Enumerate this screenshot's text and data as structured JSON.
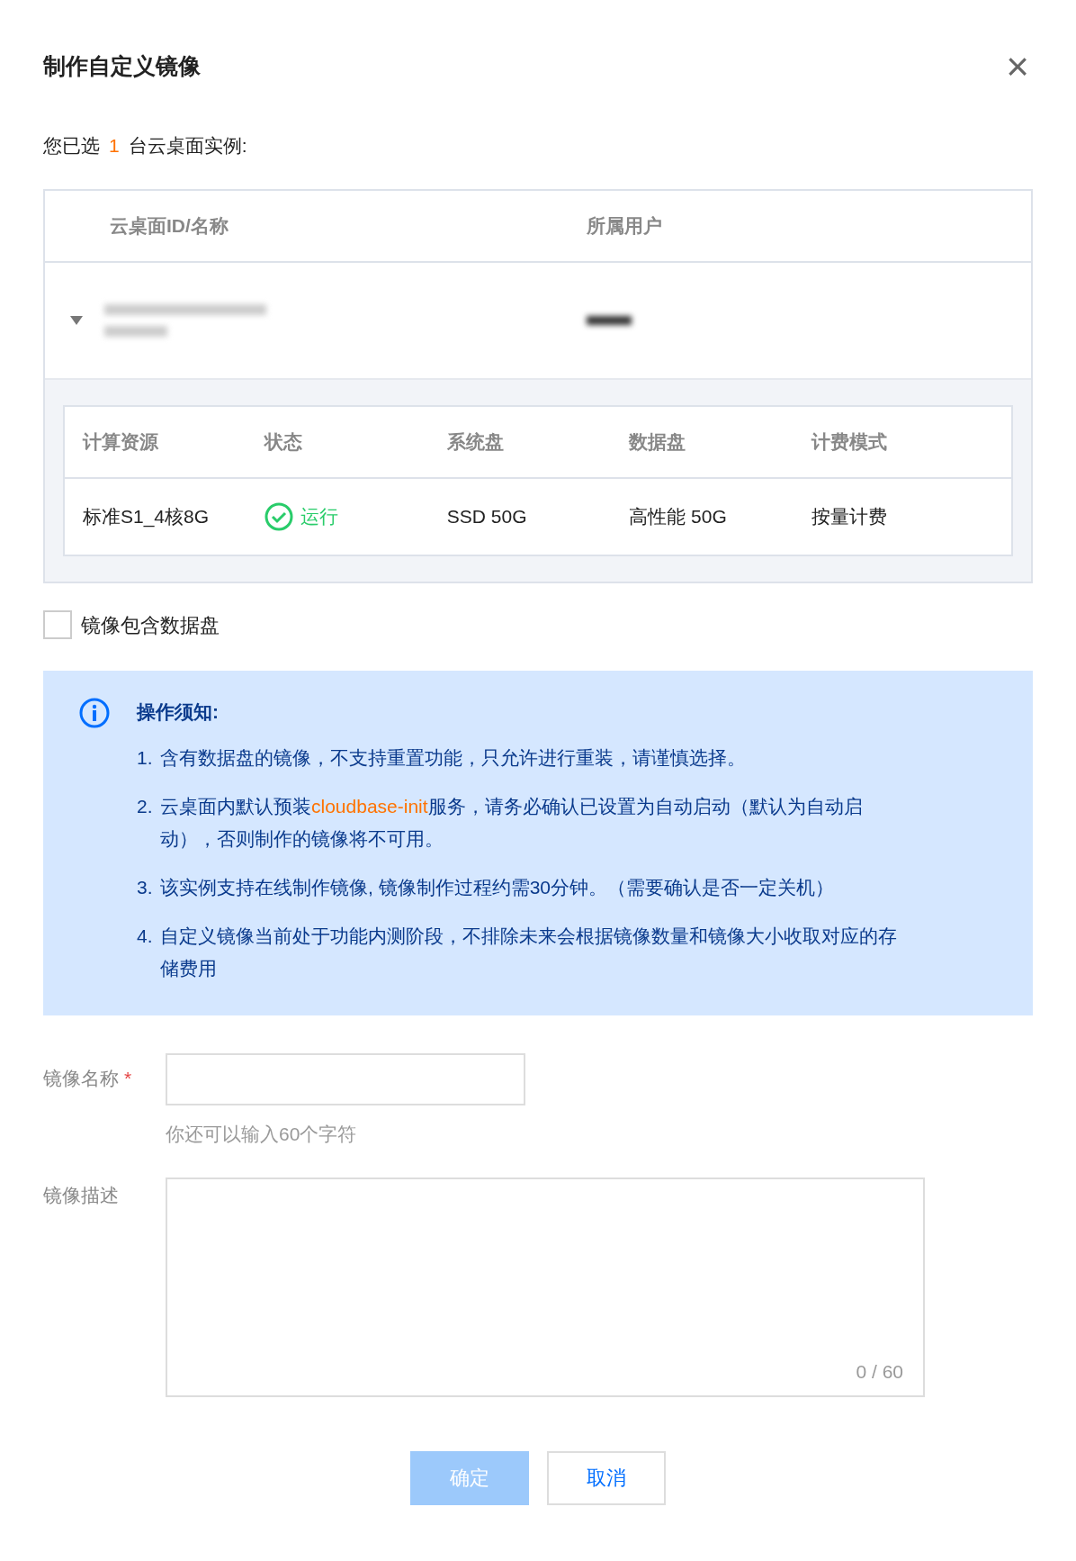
{
  "dialog": {
    "title": "制作自定义镜像",
    "close": "×"
  },
  "selection": {
    "prefix": "您已选",
    "count": "1",
    "suffix": "台云桌面实例:"
  },
  "instances_table": {
    "columns": [
      "云桌面ID/名称",
      "所属用户"
    ],
    "rows": [
      {
        "expanded": true,
        "details": {
          "columns": [
            "计算资源",
            "状态",
            "系统盘",
            "数据盘",
            "计费模式"
          ],
          "row": {
            "compute": "标准S1_4核8G",
            "status": {
              "text": "运行",
              "kind": "running"
            },
            "system_disk": "SSD 50G",
            "data_disk": "高性能 50G",
            "billing": "按量计费"
          }
        }
      }
    ]
  },
  "include_data_disk": {
    "label": "镜像包含数据盘",
    "checked": false
  },
  "notice": {
    "title": "操作须知:",
    "items": [
      {
        "number": "1.",
        "text": "含有数据盘的镜像，不支持重置功能，只允许进行重装，请谨慎选择。"
      },
      {
        "number": "2.",
        "text": "云桌面内默认预装",
        "link": "cloudbase-init",
        "after": "服务，请务必确认已设置为自动启动（默认为自动启动），否则制作的镜像将不可用。"
      },
      {
        "number": "3.",
        "text": "该实例支持在线制作镜像, 镜像制作过程约需30分钟。（需要确认是否一定关机）"
      },
      {
        "number": "4.",
        "text": "自定义镜像当前处于功能内测阶段，不排除未来会根据镜像数量和镜像大小收取对应的存储费用"
      }
    ]
  },
  "form": {
    "name_label": "镜像名称",
    "required_mark": "*",
    "name_hint": "你还可以输入60个字符",
    "desc_label": "镜像描述",
    "desc_counter": "0 / 60"
  },
  "buttons": [
    {
      "label": "确定",
      "kind": "primary",
      "disabled": true
    },
    {
      "label": "取消",
      "kind": "secondary",
      "disabled": false
    }
  ]
}
